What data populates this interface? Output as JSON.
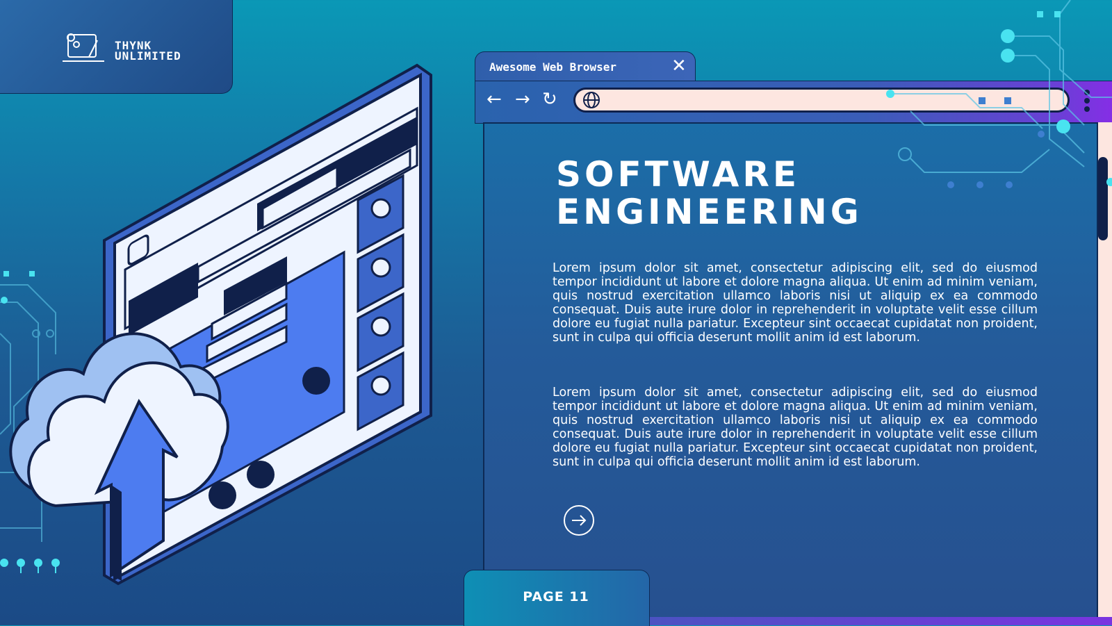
{
  "brand": {
    "line1": "THYNK",
    "line2": "UNLIMITED"
  },
  "browser": {
    "tab_title": "Awesome Web Browser",
    "close_glyph": "✕",
    "back_glyph": "←",
    "forward_glyph": "→",
    "reload_glyph": "↻"
  },
  "content": {
    "title_line1": "SOFTWARE",
    "title_line2": "ENGINEERING",
    "paragraph1": "Lorem ipsum dolor sit amet, consectetur adipiscing elit, sed do eiusmod tempor incididunt ut labore et dolore magna aliqua. Ut enim ad minim veniam, quis nostrud exercitation ullamco laboris nisi ut aliquip ex ea commodo consequat. Duis aute irure dolor in reprehenderit in voluptate velit esse cillum dolore eu fugiat nulla pariatur. Excepteur sint occaecat cupidatat non proident, sunt in culpa qui officia deserunt mollit anim id est laborum.",
    "paragraph2": "Lorem ipsum dolor sit amet, consectetur adipiscing elit, sed do eiusmod tempor incididunt ut labore et dolore magna aliqua. Ut enim ad minim veniam, quis nostrud exercitation ullamco laboris nisi ut aliquip ex ea commodo consequat. Duis aute irure dolor in reprehenderit in voluptate velit esse cillum dolore eu fugiat nulla pariatur. Excepteur sint occaecat cupidatat non proident, sunt in culpa qui officia deserunt mollit anim id est laborum."
  },
  "footer": {
    "page_label": "PAGE 11"
  },
  "icons": [
    "laptop-gears-icon",
    "globe-icon",
    "menu-dots-icon",
    "arrow-right-circle-icon",
    "cloud-upload-icon",
    "user-icon",
    "phone-icon",
    "speaker-icon"
  ],
  "colors": {
    "accent_cyan": "#49e3f0",
    "navy": "#10204a",
    "address_bar": "#fde6e0",
    "purple": "#8a2be8"
  }
}
